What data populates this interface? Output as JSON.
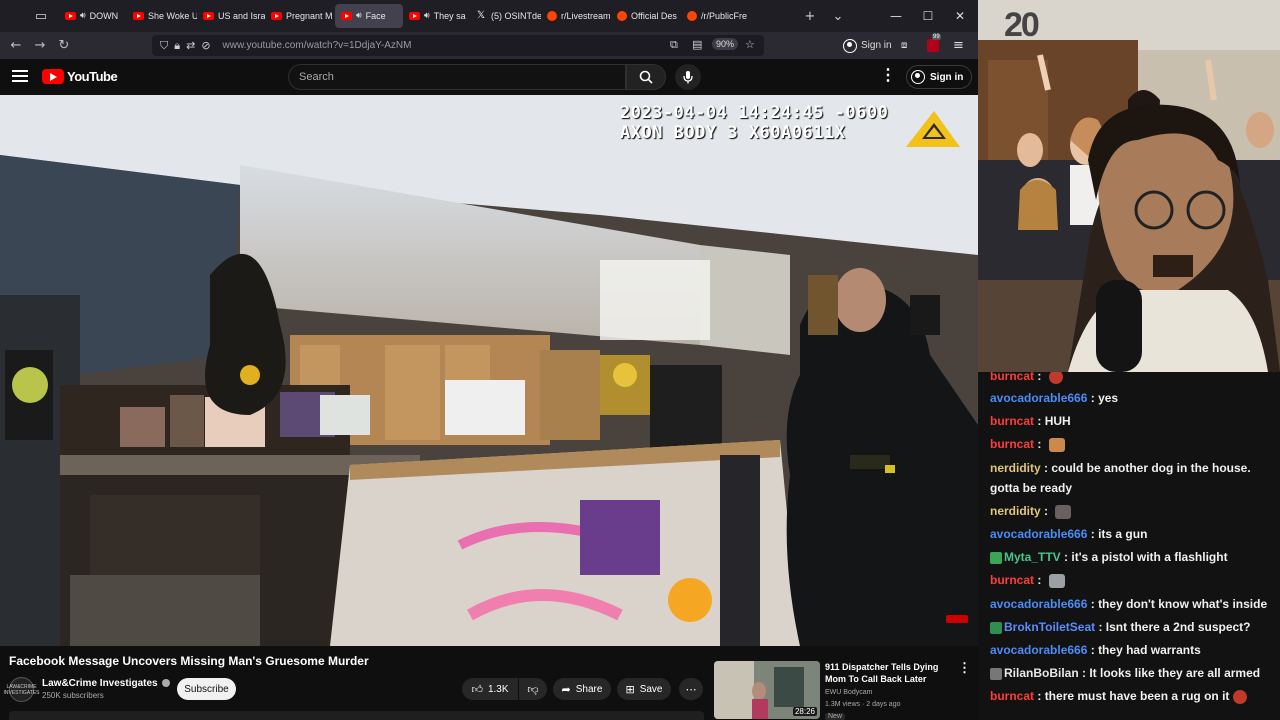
{
  "browser": {
    "tabs": [
      {
        "label": "DOWN",
        "favicon": "youtube",
        "audio": true
      },
      {
        "label": "She Woke U",
        "favicon": "youtube"
      },
      {
        "label": "US and Isra",
        "favicon": "youtube"
      },
      {
        "label": "Pregnant M",
        "favicon": "youtube"
      },
      {
        "label": "Face",
        "favicon": "youtube",
        "audio": true,
        "active": true
      },
      {
        "label": "They sa",
        "favicon": "youtube",
        "audio": true
      },
      {
        "label": "(5) OSINTde",
        "favicon": "x"
      },
      {
        "label": "r/Livestream",
        "favicon": "reddit"
      },
      {
        "label": "Official Des",
        "favicon": "reddit"
      },
      {
        "label": "/r/PublicFre",
        "favicon": "reddit"
      }
    ],
    "url": "www.youtube.com/watch?v=1DdjaY-AzNM",
    "zoom": "90%",
    "sign_in": "Sign in",
    "ext_badge": "99"
  },
  "youtube": {
    "logo_text": "YouTube",
    "search_placeholder": "Search",
    "sign_in": "Sign in",
    "video": {
      "overlay_line1": "2023-04-04 14:24:45 -0600",
      "overlay_line2": "AXON BODY 3 X60A0611X",
      "title": "Facebook Message Uncovers Missing Man's Gruesome Murder",
      "channel": "Law&Crime Investigates",
      "subscribers": "250K subscribers",
      "avatar_text": "LAW&CRIME INVESTIGATES",
      "subscribe": "Subscribe",
      "likes": "1.3K",
      "share": "Share",
      "save": "Save"
    },
    "recommended": {
      "title": "911 Dispatcher Tells Dying Mom To Call Back Later",
      "channel": "EWU Bodycam",
      "meta": "1.3M views · 2 days ago",
      "badge": "New",
      "duration": "28:26"
    }
  },
  "webcam": {
    "background_number": "20"
  },
  "chat": {
    "messages": [
      {
        "user": "burncat",
        "color": "#ff3b3b",
        "text": "",
        "emote": "red-ball"
      },
      {
        "user": "avocadorable666",
        "color": "#4c8cf5",
        "text": "yes"
      },
      {
        "user": "burncat",
        "color": "#ff3b3b",
        "text": "HUH"
      },
      {
        "user": "burncat",
        "color": "#ff3b3b",
        "text": "",
        "emote": "cat"
      },
      {
        "user": "nerdidity",
        "color": "#e2c47b",
        "text": "could be another dog in the house. gotta be ready"
      },
      {
        "user": "nerdidity",
        "color": "#e2c47b",
        "text": "",
        "emote": "dog"
      },
      {
        "user": "avocadorable666",
        "color": "#4c8cf5",
        "text": "its a gun"
      },
      {
        "user": "Myta_TTV",
        "color": "#47c78b",
        "text": "it's a pistol with a flashlight",
        "badges": true
      },
      {
        "user": "burncat",
        "color": "#ff3b3b",
        "text": "",
        "emote": "gun"
      },
      {
        "user": "avocadorable666",
        "color": "#4c8cf5",
        "text": "they don't know what's inside"
      },
      {
        "user": "BroknToiletSeat",
        "color": "#5b8cff",
        "text": "Isnt there a 2nd suspect?",
        "badges": true
      },
      {
        "user": "avocadorable666",
        "color": "#4c8cf5",
        "text": "they had warrants"
      },
      {
        "user": "RilanBoBilan",
        "color": "#e8e8e8",
        "text": "It looks like they are all armed",
        "badges": true
      },
      {
        "user": "burncat",
        "color": "#ff3b3b",
        "text": "there must have been a rug on it",
        "emote": "red-ball"
      }
    ]
  }
}
